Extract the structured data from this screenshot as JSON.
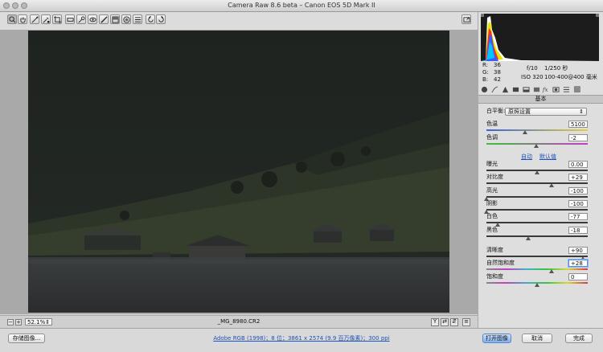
{
  "window": {
    "title": "Camera Raw 8.6 beta –  Canon EOS 5D Mark II"
  },
  "toolbar": {
    "tools": [
      "zoom-icon",
      "hand-icon",
      "white-balance-icon",
      "color-sampler-icon",
      "crop-icon",
      "straighten-icon",
      "spot-removal-icon",
      "red-eye-icon",
      "adjustment-brush-icon",
      "graduated-filter-icon",
      "radial-filter-icon",
      "preferences-icon",
      "rotate-ccw-icon",
      "rotate-cw-icon"
    ],
    "fullscreen_icon": "fullscreen-icon"
  },
  "histogram": {
    "r_label": "R:",
    "r_value": "36",
    "g_label": "G:",
    "g_value": "38",
    "b_label": "B:",
    "b_value": "42",
    "aperture": "f/10",
    "shutter": "1/250 秒",
    "iso": "ISO 320",
    "lens": "100-400@400 毫米"
  },
  "panel": {
    "section_title": "基本",
    "wb_label": "白平衡:",
    "wb_value": "原照设置",
    "auto_label": "自动",
    "default_label": "默认值",
    "sliders": [
      {
        "label": "色温",
        "value": "5100",
        "pos": 0.38,
        "color": "temp"
      },
      {
        "label": "色调",
        "value": "-2",
        "pos": 0.49,
        "color": "tint"
      },
      {
        "label": "曝光",
        "value": "0.00",
        "pos": 0.5,
        "color": "gray"
      },
      {
        "label": "对比度",
        "value": "+29",
        "pos": 0.645,
        "color": "gray"
      },
      {
        "label": "高光",
        "value": "-100",
        "pos": 0.0,
        "color": "gray"
      },
      {
        "label": "阴影",
        "value": "-100",
        "pos": 0.0,
        "color": "gray"
      },
      {
        "label": "白色",
        "value": "-77",
        "pos": 0.115,
        "color": "gray"
      },
      {
        "label": "黑色",
        "value": "-18",
        "pos": 0.41,
        "color": "gray"
      },
      {
        "label": "清晰度",
        "value": "+90",
        "pos": 0.95,
        "color": "gray"
      },
      {
        "label": "自然饱和度",
        "value": "+28",
        "pos": 0.64,
        "color": "sat"
      },
      {
        "label": "饱和度",
        "value": "0",
        "pos": 0.5,
        "color": "sat"
      }
    ]
  },
  "status": {
    "zoom": "52.1%",
    "filename": "_MG_8980.CR2"
  },
  "footer": {
    "save_label": "存储图像...",
    "workflow_info": "Adobe RGB (1998)；8 位；3861 x 2574 (9.9 百万像素)；300 ppi",
    "open_label": "打开图像",
    "cancel_label": "取消",
    "done_label": "完成"
  }
}
